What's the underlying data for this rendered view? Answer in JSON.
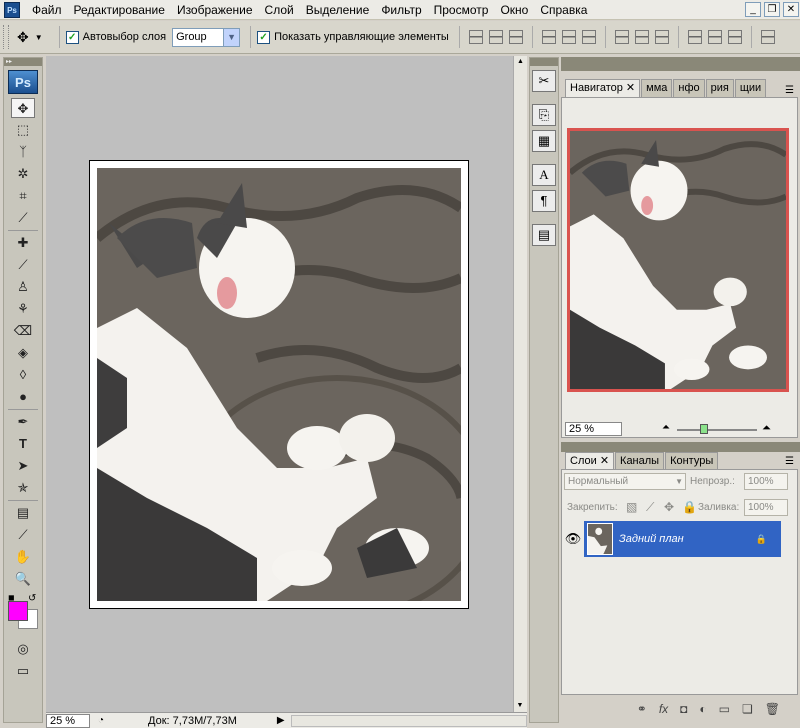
{
  "app": {
    "logo": "Ps"
  },
  "menu": {
    "items": [
      "Файл",
      "Редактирование",
      "Изображение",
      "Слой",
      "Выделение",
      "Фильтр",
      "Просмотр",
      "Окно",
      "Справка"
    ]
  },
  "options": {
    "autoselect_label": "Автовыбор слоя",
    "autoselect_checked": true,
    "autoselect_value": "Group",
    "show_controls_label": "Показать управляющие элементы",
    "show_controls_checked": true
  },
  "navigator": {
    "tabs": [
      "Навигатор",
      "мма",
      "нфо",
      "рия",
      "щии"
    ],
    "zoom": "25 %"
  },
  "layers_panel": {
    "tabs": [
      "Слои",
      "Каналы",
      "Контуры"
    ],
    "blend_mode": "Нормальный",
    "opacity_label": "Непрозр.:",
    "opacity_value": "100%",
    "lock_label": "Закрепить:",
    "fill_label": "Заливка:",
    "fill_value": "100%",
    "layers": [
      {
        "name": "Задний план",
        "visible": true,
        "locked": true
      }
    ],
    "footer_icons": [
      "link-icon",
      "fx-icon",
      "mask-icon",
      "adjustment-icon",
      "group-icon",
      "new-layer-icon",
      "trash-icon"
    ]
  },
  "status": {
    "zoom": "25 %",
    "doc_info": "Док: 7,73M/7,73M"
  },
  "colors": {
    "foreground": "#ff00ff",
    "background": "#ffffff",
    "selection": "#3164c4",
    "nav_frame": "#d9534f"
  }
}
